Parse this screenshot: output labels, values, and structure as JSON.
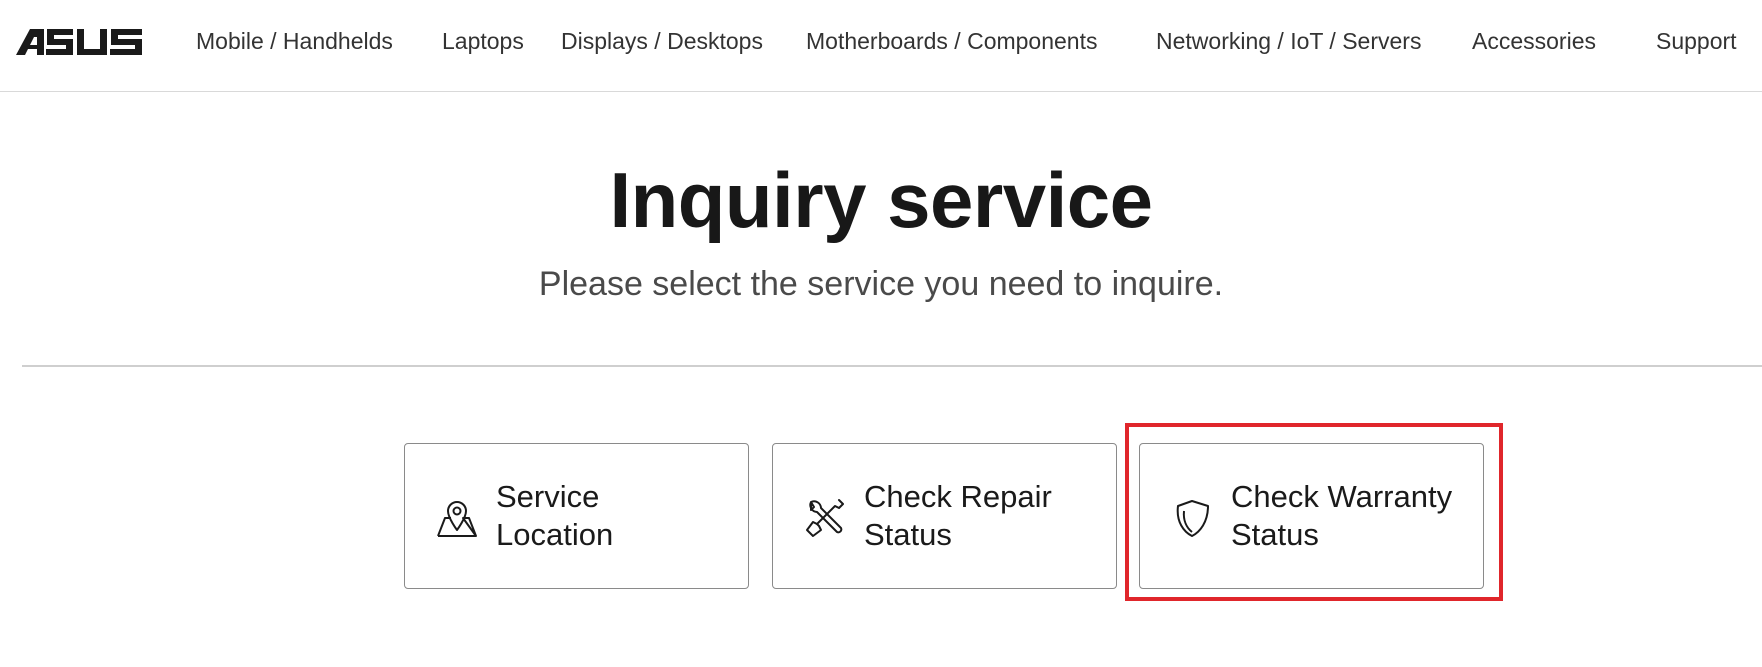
{
  "header": {
    "logo_alt": "ASUS",
    "nav": [
      "Mobile / Handhelds",
      "Laptops",
      "Displays / Desktops",
      "Motherboards / Components",
      "Networking / IoT / Servers",
      "Accessories",
      "Support"
    ]
  },
  "main": {
    "title": "Inquiry service",
    "subtitle": "Please select the service you need to inquire.",
    "cards": [
      {
        "line1": "Service",
        "line2": "Location",
        "icon": "map-pin-icon"
      },
      {
        "line1": "Check Repair",
        "line2": "Status",
        "icon": "tools-icon"
      },
      {
        "line1": "Check Warranty",
        "line2": "Status",
        "icon": "shield-icon"
      }
    ]
  },
  "colors": {
    "highlight": "#e0262b",
    "text": "#1a1a1a",
    "divider": "#cfcfcf"
  }
}
